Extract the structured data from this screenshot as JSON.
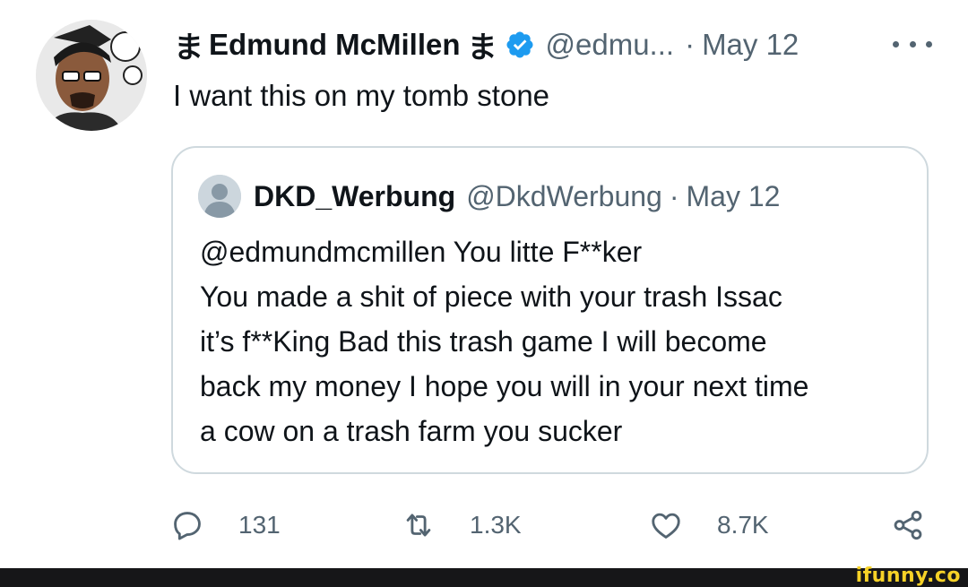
{
  "tweet": {
    "author_name": "Edmund McMillen",
    "name_glyph_before": "ま",
    "name_glyph_after": "ま",
    "verified_icon": "verified-badge-icon",
    "handle": "@edmu...",
    "separator": "·",
    "date": "May 12",
    "more_icon": "more-dots-icon",
    "text": "I want this on my tomb stone"
  },
  "quote": {
    "author_name": "DKD_Werbung",
    "handle": "@DkdWerbung",
    "separator": "·",
    "date": "May 12",
    "lines": [
      "@edmundmcmillen You litte F**ker",
      "You made a shit of piece with your trash Issac",
      "it’s f**King Bad this trash game I will become",
      "back my money I hope you will in your next time",
      "a cow on a trash farm you sucker"
    ]
  },
  "actions": {
    "reply": {
      "icon": "reply-icon",
      "count": "131"
    },
    "retweet": {
      "icon": "retweet-icon",
      "count": "1.3K"
    },
    "like": {
      "icon": "heart-icon",
      "count": "8.7K"
    },
    "share": {
      "icon": "share-icon"
    }
  },
  "watermark": {
    "text": "ifunny.co"
  },
  "colors": {
    "text_primary": "#0f1419",
    "text_secondary": "#536471",
    "verified_blue": "#1d9bf0",
    "border": "#cfd9de",
    "footer_bg": "#161618",
    "watermark": "#f7d227"
  }
}
